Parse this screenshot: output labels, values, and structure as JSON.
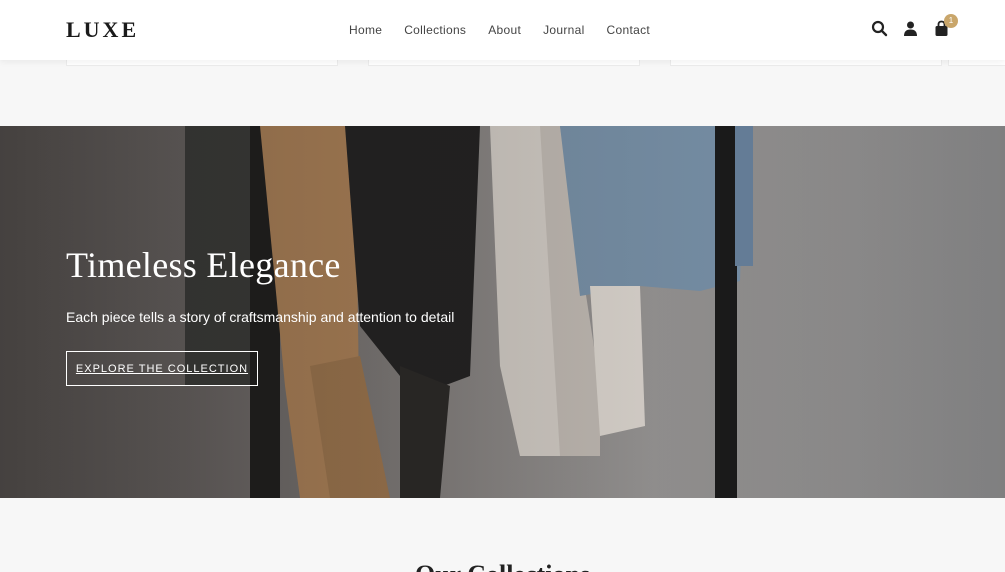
{
  "header": {
    "logo": "LUXE",
    "nav": [
      "Home",
      "Collections",
      "About",
      "Journal",
      "Contact"
    ],
    "cart_count": "1"
  },
  "hero": {
    "title": "Timeless Elegance",
    "subtitle": "Each piece tells a story of craftsmanship and attention to detail",
    "cta": "EXPLORE THE COLLECTION"
  },
  "next_section": {
    "title": "Our Collections"
  },
  "icons": [
    "search-icon",
    "user-icon",
    "shopping-bag-icon"
  ],
  "colors": {
    "accent": "#c9a66b",
    "header_bg": "#ffffff",
    "page_bg": "#f7f7f7"
  }
}
